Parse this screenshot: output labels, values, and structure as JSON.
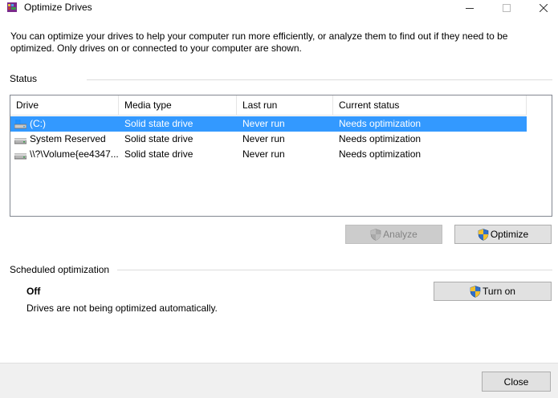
{
  "window": {
    "title": "Optimize Drives",
    "minimize_icon": "minimize-icon",
    "maximize_icon": "maximize-icon",
    "close_icon": "close-icon"
  },
  "description": "You can optimize your drives to help your computer run more efficiently, or analyze them to find out if they need to be optimized. Only drives on or connected to your computer are shown.",
  "status": {
    "label": "Status",
    "columns": [
      "Drive",
      "Media type",
      "Last run",
      "Current status"
    ],
    "rows": [
      {
        "drive": "(C:)",
        "media_type": "Solid state drive",
        "last_run": "Never run",
        "current_status": "Needs optimization",
        "selected": true,
        "icon": "windows-drive-icon"
      },
      {
        "drive": "System Reserved",
        "media_type": "Solid state drive",
        "last_run": "Never run",
        "current_status": "Needs optimization",
        "selected": false,
        "icon": "drive-icon"
      },
      {
        "drive": "\\\\?\\Volume{ee4347...",
        "media_type": "Solid state drive",
        "last_run": "Never run",
        "current_status": "Needs optimization",
        "selected": false,
        "icon": "drive-icon"
      }
    ],
    "selection_color": "#3399ff"
  },
  "actions": {
    "analyze_label": "Analyze",
    "optimize_label": "Optimize"
  },
  "scheduled": {
    "label": "Scheduled optimization",
    "state": "Off",
    "description": "Drives are not being optimized automatically.",
    "turn_on_label": "Turn on"
  },
  "footer": {
    "close_label": "Close"
  }
}
